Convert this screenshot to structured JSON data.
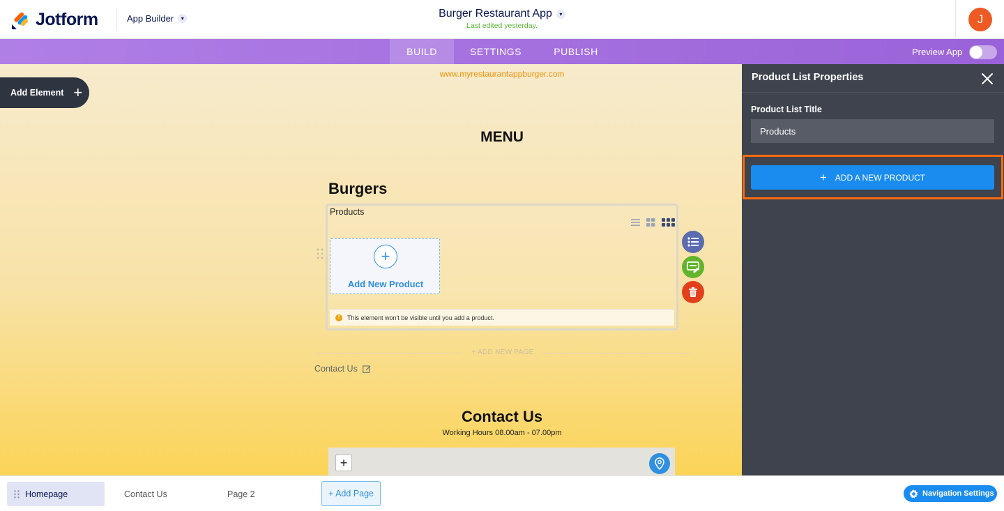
{
  "header": {
    "brand": "Jotform",
    "app_builder_label": "App Builder",
    "app_title": "Burger Restaurant App",
    "last_edited": "Last edited yesterday.",
    "avatar_initial": "J"
  },
  "nav": {
    "tabs": [
      {
        "label": "BUILD",
        "active": true
      },
      {
        "label": "SETTINGS",
        "active": false
      },
      {
        "label": "PUBLISH",
        "active": false
      }
    ],
    "preview_label": "Preview App",
    "preview_enabled": false
  },
  "canvas": {
    "site_url": "www.myrestaurantappburger.com",
    "add_element_label": "Add Element",
    "menu_heading": "MENU",
    "section_heading": "Burgers",
    "product_list": {
      "title": "Products",
      "view_icons": [
        "list-view-icon",
        "grid-view-icon",
        "compact-grid-view-icon"
      ],
      "add_card_label": "Add New Product",
      "warning": "This element won't be visible until you add a product."
    },
    "add_new_page_label": "+ ADD NEW PAGE",
    "contact_page_label": "Contact Us",
    "contact_heading": "Contact Us",
    "working_hours": "Working Hours 08.00am - 07.00pm",
    "map_zoom_label": "+"
  },
  "panel": {
    "title": "Product List Properties",
    "field_label": "Product List Title",
    "field_value": "Products",
    "add_product_label": "ADD A NEW PRODUCT"
  },
  "bottom": {
    "pages": [
      {
        "label": "Homepage",
        "active": true
      },
      {
        "label": "Contact Us",
        "active": false
      },
      {
        "label": "Page 2",
        "active": false
      }
    ],
    "add_page_label": "+ Add Page",
    "nav_settings_label": "Navigation Settings"
  },
  "colors": {
    "accent": "#1a8cf0",
    "nav_purple": "#a572e0",
    "highlight": "#ff6a0e",
    "panel_bg": "#3e434d",
    "delete_red": "#e2401c",
    "edit_green": "#62b42b"
  }
}
